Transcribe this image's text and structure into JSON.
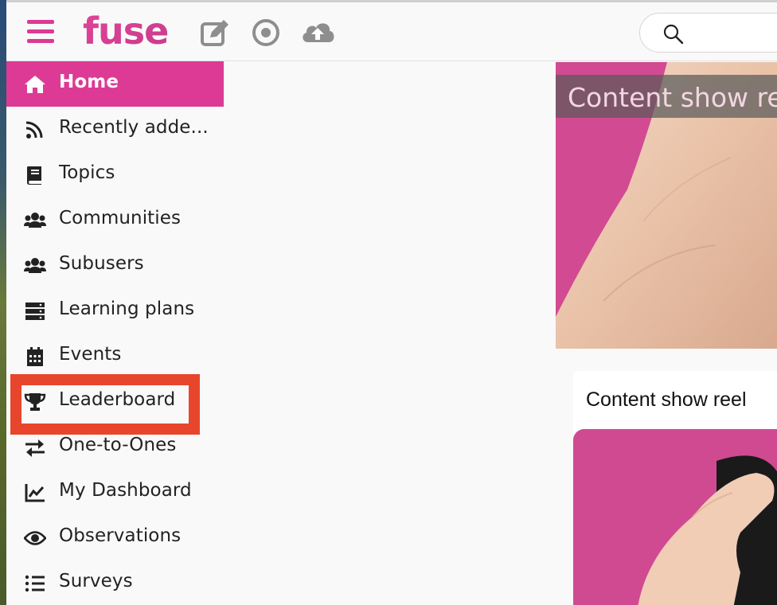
{
  "app": {
    "logo_text": "fuse",
    "accent_color": "#dc3a95",
    "highlight_color": "#e8462c"
  },
  "toolbar": {
    "menu_icon": "hamburger-menu-icon",
    "icons": [
      "edit-icon",
      "record-icon",
      "cloud-upload-icon"
    ],
    "search_placeholder": "",
    "search_icon": "search-icon"
  },
  "sidebar": {
    "items": [
      {
        "label": "Home",
        "icon": "home-icon",
        "active": true
      },
      {
        "label": "Recently adde...",
        "icon": "rss-icon"
      },
      {
        "label": "Topics",
        "icon": "book-icon"
      },
      {
        "label": "Communities",
        "icon": "users-icon"
      },
      {
        "label": "Subusers",
        "icon": "users-icon"
      },
      {
        "label": "Learning plans",
        "icon": "server-icon"
      },
      {
        "label": "Events",
        "icon": "calendar-icon"
      },
      {
        "label": "Leaderboard",
        "icon": "trophy-icon",
        "highlighted": true
      },
      {
        "label": "One-to-Ones",
        "icon": "exchange-icon"
      },
      {
        "label": "My Dashboard",
        "icon": "chart-line-icon"
      },
      {
        "label": "Observations",
        "icon": "eye-icon"
      },
      {
        "label": "Surveys",
        "icon": "list-icon"
      }
    ]
  },
  "main": {
    "hero_caption": "Content show ree",
    "card_title": "Content show reel"
  }
}
